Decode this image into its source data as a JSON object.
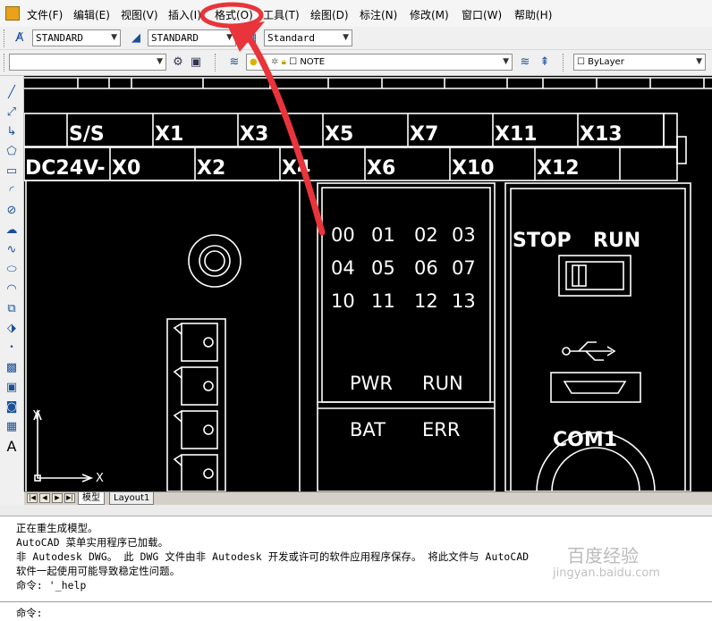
{
  "menu": {
    "items": [
      "文件(F)",
      "编辑(E)",
      "视图(V)",
      "插入(I)",
      "格式(O)",
      "工具(T)",
      "绘图(D)",
      "标注(N)",
      "修改(M)",
      "窗口(W)",
      "帮助(H)"
    ]
  },
  "toolbar1": {
    "text_style": "STANDARD",
    "dim_style": "STANDARD",
    "table_style": "Standard"
  },
  "toolbar2": {
    "workspace": "",
    "layer": "NOTE",
    "color": "ByLayer"
  },
  "left_toolbar": {
    "text_tool": "A"
  },
  "drawing": {
    "top_row_labels": [
      "S/S",
      "X1",
      "X3",
      "X5",
      "X7",
      "X11",
      "X13"
    ],
    "second_row_labels": [
      "DC24V-",
      "X0",
      "X2",
      "X4",
      "X6",
      "X10",
      "X12"
    ],
    "io_numbers": [
      [
        "00",
        "01",
        "02",
        "03"
      ],
      [
        "04",
        "05",
        "06",
        "07"
      ],
      [
        "10",
        "11",
        "12",
        "13"
      ]
    ],
    "status_labels": [
      "PWR",
      "RUN",
      "BAT",
      "ERR"
    ],
    "switch_labels": [
      "STOP",
      "RUN"
    ],
    "port_label": "COM1",
    "ucs_y": "Y",
    "ucs_x": "X"
  },
  "layout_tabs": [
    "模型",
    "Layout1"
  ],
  "command_history": [
    "正在重生成模型。",
    "AutoCAD 菜单实用程序已加载。",
    "非 Autodesk DWG。  此 DWG 文件由非 Autodesk 开发或许可的软件应用程序保存。  将此文件与 AutoCAD",
    "软件一起使用可能导致稳定性问题。",
    "命令: '_help"
  ],
  "command_prompt": "命令:",
  "watermark": {
    "line1": "百度经验",
    "line2": "jingyan.baidu.com"
  },
  "colors": {
    "annotation_arrow": "#e8343a",
    "canvas": "#000000",
    "linework": "#ffffff"
  }
}
